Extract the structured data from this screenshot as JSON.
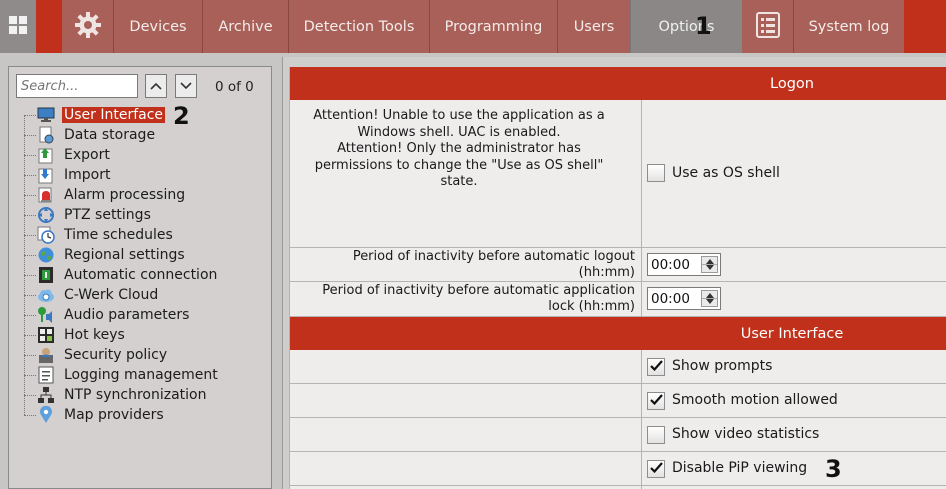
{
  "nav": {
    "items": [
      {
        "id": "devices",
        "label": "Devices"
      },
      {
        "id": "archive",
        "label": "Archive"
      },
      {
        "id": "detection-tools",
        "label": "Detection Tools"
      },
      {
        "id": "programming",
        "label": "Programming"
      },
      {
        "id": "users",
        "label": "Users"
      },
      {
        "id": "options",
        "label": "Options",
        "active": true
      },
      {
        "id": "system-log",
        "label": "System log"
      }
    ],
    "icons": {
      "home": "grid-icon",
      "settings": "gear-icon",
      "system_log": "document-list-icon"
    }
  },
  "callouts": {
    "one": "1",
    "two": "2",
    "three": "3"
  },
  "left_panel": {
    "search": {
      "placeholder": "Search...",
      "value": ""
    },
    "counter": "0 of 0",
    "tree": [
      {
        "label": "User Interface",
        "icon": "monitor-icon",
        "selected": true
      },
      {
        "label": "Data storage",
        "icon": "data-storage-icon"
      },
      {
        "label": "Export",
        "icon": "export-icon"
      },
      {
        "label": "Import",
        "icon": "import-icon"
      },
      {
        "label": "Alarm processing",
        "icon": "alarm-icon"
      },
      {
        "label": "PTZ settings",
        "icon": "ptz-icon"
      },
      {
        "label": "Time schedules",
        "icon": "clock-icon"
      },
      {
        "label": "Regional settings",
        "icon": "globe-icon"
      },
      {
        "label": "Automatic connection",
        "icon": "connection-icon"
      },
      {
        "label": "C-Werk Cloud",
        "icon": "cloud-icon"
      },
      {
        "label": "Audio parameters",
        "icon": "audio-icon"
      },
      {
        "label": "Hot keys",
        "icon": "keyboard-icon"
      },
      {
        "label": "Security policy",
        "icon": "security-icon"
      },
      {
        "label": "Logging management",
        "icon": "log-icon"
      },
      {
        "label": "NTP synchronization",
        "icon": "network-icon"
      },
      {
        "label": "Map providers",
        "icon": "map-pin-icon"
      }
    ]
  },
  "main": {
    "logon": {
      "header": "Logon",
      "warning_lines": [
        "Attention! Unable to use the application as a",
        "Windows shell. UAC is enabled.",
        "Attention! Only the administrator has",
        "permissions to change the \"Use as OS shell\"",
        "state."
      ],
      "use_as_shell": {
        "label": "Use as OS shell",
        "checked": false
      },
      "logout": {
        "label_lines": [
          "Period of inactivity before automatic logout",
          "(hh:mm)"
        ],
        "value": "00:00"
      },
      "lock": {
        "label_lines": [
          "Period of inactivity before automatic application",
          "lock (hh:mm)"
        ],
        "value": "00:00"
      }
    },
    "user_interface": {
      "header": "User Interface",
      "options": [
        {
          "label": "Show prompts",
          "checked": true
        },
        {
          "label": "Smooth motion allowed",
          "checked": true
        },
        {
          "label": "Show video statistics",
          "checked": false
        },
        {
          "label": "Disable PiP viewing",
          "checked": true
        }
      ]
    }
  },
  "colors": {
    "accent": "#c0301a",
    "nav_bg": "#a86058",
    "nav_active": "#8a8786"
  }
}
